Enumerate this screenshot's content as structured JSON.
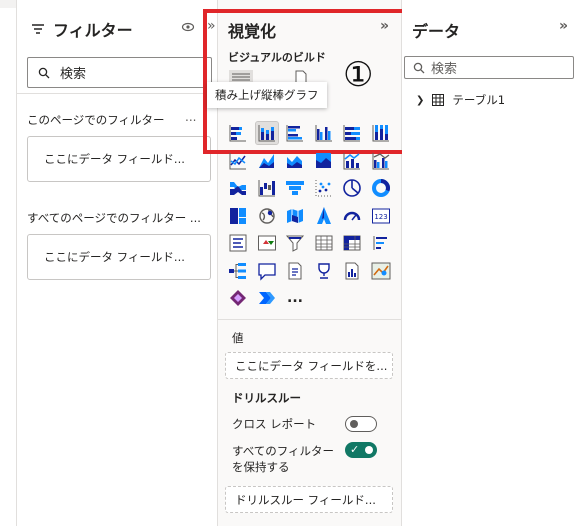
{
  "filters": {
    "title": "フィルター",
    "search_placeholder": "検索",
    "page_section_label": "このページでのフィルター",
    "page_section_more": "...",
    "page_dropzone": "ここにデータ フィールド...",
    "all_section_label": "すべてのページでのフィルター ...",
    "all_dropzone": "ここにデータ フィールド..."
  },
  "visualizations": {
    "title": "視覚化",
    "expand_glyph": "»",
    "build_label": "ビジュアルのビルド",
    "tooltip": "積み上げ縦棒グラフ",
    "annotation_badge": "①",
    "more_glyph": "...",
    "icons": [
      "stacked-bar-chart-icon",
      "stacked-column-chart-icon",
      "clustered-bar-chart-icon",
      "clustered-column-chart-icon",
      "100-stacked-bar-chart-icon",
      "100-stacked-column-chart-icon",
      "line-chart-icon",
      "area-chart-icon",
      "stacked-area-chart-icon",
      "100-stacked-area-chart-icon",
      "line-and-stacked-column-icon",
      "line-and-clustered-column-icon",
      "ribbon-chart-icon",
      "waterfall-chart-icon",
      "funnel-chart-icon",
      "scatter-chart-icon",
      "pie-chart-icon",
      "donut-chart-icon",
      "treemap-icon",
      "map-icon",
      "filled-map-icon",
      "azure-map-icon",
      "gauge-icon",
      "card-icon",
      "multi-row-card-icon",
      "kpi-icon",
      "slicer-icon",
      "table-icon",
      "matrix-icon",
      "key-influencers-icon",
      "decomposition-tree-icon",
      "qna-icon",
      "smart-narrative-icon",
      "metrics-icon",
      "paginated-report-icon",
      "arcgis-map-icon",
      "power-apps-icon",
      "power-automate-icon"
    ],
    "values_label": "値",
    "values_dropzone": "ここにデータ フィールドを...",
    "drillthrough_label": "ドリルスルー",
    "cross_report_label": "クロス レポート",
    "cross_report_on": false,
    "keep_filters_label_1": "すべてのフィルター",
    "keep_filters_label_2": "を保持する",
    "keep_filters_on": true,
    "drillthrough_dropzone": "ドリルスルー フィールド..."
  },
  "data_pane": {
    "title": "データ",
    "expand_glyph": "»",
    "search_placeholder": "検索",
    "table_name": "テーブル1"
  },
  "colors": {
    "accent_blue": "#118dff",
    "dark_navy": "#12239e",
    "highlight_red": "#e0262a",
    "toggle_on": "#117865"
  }
}
